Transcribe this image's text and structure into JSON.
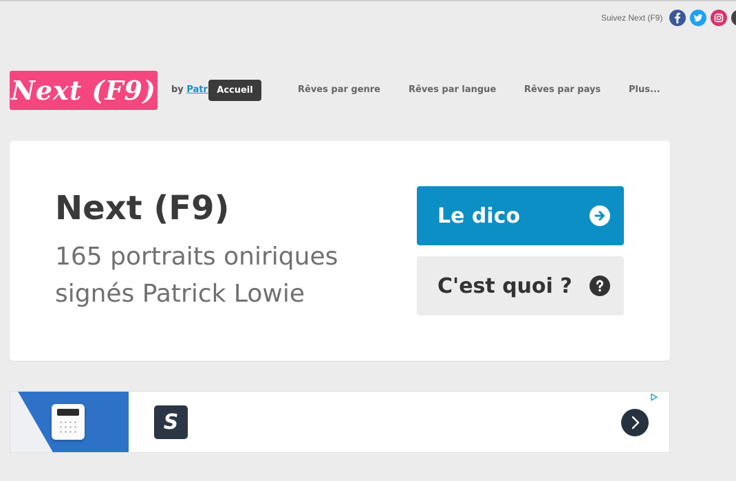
{
  "social": {
    "follow_text": "Suivez Next (F9)",
    "icons": [
      "facebook-icon",
      "twitter-icon",
      "instagram-icon"
    ],
    "colors": {
      "facebook": "#3b5998",
      "twitter": "#1da1f2",
      "instagram": "#d6336c"
    }
  },
  "header": {
    "logo_text": "Next (F9)",
    "byline_prefix": "by ",
    "byline_link": "Patri",
    "tooltip": "Accueil",
    "nav": [
      "Rêves par genre",
      "Rêves par langue",
      "Rêves par pays",
      "Plus..."
    ]
  },
  "hero": {
    "title": "Next (F9)",
    "subtitle_line1": "165 portraits oniriques",
    "subtitle_line2": "signés Patrick Lowie",
    "btn_dico": "Le dico",
    "btn_quoi": "C'est quoi ?"
  },
  "ad": {
    "brand_letter": "S"
  },
  "colors": {
    "logo_bg": "#f5467f",
    "primary_button": "#0b8fc4",
    "secondary_button": "#ececec",
    "page_bg": "#ececec"
  }
}
